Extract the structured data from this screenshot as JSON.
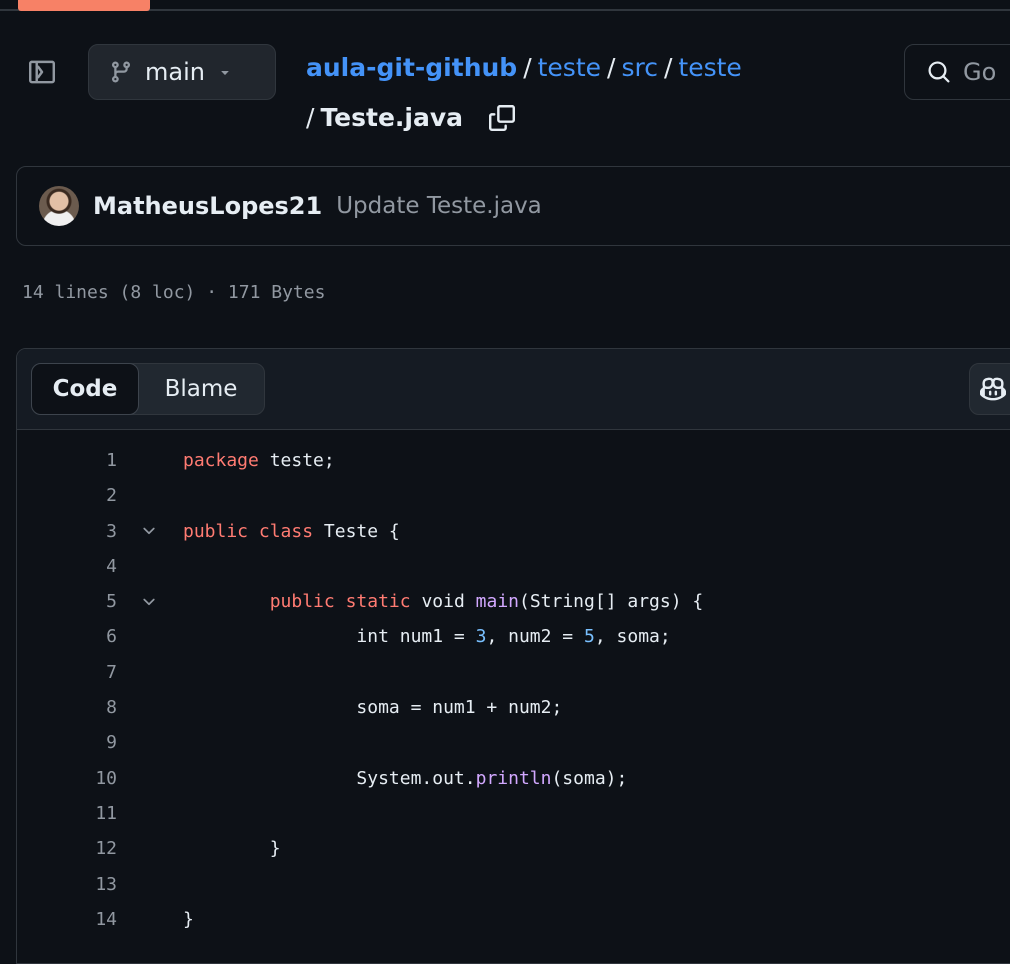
{
  "branch": {
    "name": "main"
  },
  "breadcrumb": {
    "repo": "aula-git-github",
    "parts": [
      "teste",
      "src",
      "teste"
    ],
    "separator": "/",
    "file": "Teste.java"
  },
  "search": {
    "placeholder": "Go to file",
    "visible_text": "Go"
  },
  "commit": {
    "author": "MatheusLopes21",
    "message": "Update Teste.java"
  },
  "file_meta": "14 lines (8 loc) · 171 Bytes",
  "view_tabs": {
    "code_label": "Code",
    "blame_label": "Blame"
  },
  "code": {
    "lines": [
      {
        "n": "1",
        "fold": false,
        "tokens": [
          [
            "kw",
            "package"
          ],
          [
            "t",
            " teste;"
          ]
        ]
      },
      {
        "n": "2",
        "fold": false,
        "tokens": []
      },
      {
        "n": "3",
        "fold": true,
        "tokens": [
          [
            "kw",
            "public"
          ],
          [
            "t",
            " "
          ],
          [
            "kw",
            "class"
          ],
          [
            "t",
            " Teste {"
          ]
        ]
      },
      {
        "n": "4",
        "fold": false,
        "tokens": []
      },
      {
        "n": "5",
        "fold": true,
        "tokens": [
          [
            "t",
            "\t"
          ],
          [
            "kw",
            "public"
          ],
          [
            "t",
            " "
          ],
          [
            "kw",
            "static"
          ],
          [
            "t",
            " void "
          ],
          [
            "fn",
            "main"
          ],
          [
            "t",
            "(String[] args) {"
          ]
        ]
      },
      {
        "n": "6",
        "fold": false,
        "tokens": [
          [
            "t",
            "\t\tint num1 = "
          ],
          [
            "num",
            "3"
          ],
          [
            "t",
            ", num2 = "
          ],
          [
            "num",
            "5"
          ],
          [
            "t",
            ", soma;"
          ]
        ]
      },
      {
        "n": "7",
        "fold": false,
        "tokens": []
      },
      {
        "n": "8",
        "fold": false,
        "tokens": [
          [
            "t",
            "\t\tsoma = num1 + num2;"
          ]
        ]
      },
      {
        "n": "9",
        "fold": false,
        "tokens": []
      },
      {
        "n": "10",
        "fold": false,
        "tokens": [
          [
            "t",
            "\t\tSystem.out."
          ],
          [
            "fn",
            "println"
          ],
          [
            "t",
            "(soma);"
          ]
        ]
      },
      {
        "n": "11",
        "fold": false,
        "tokens": []
      },
      {
        "n": "12",
        "fold": false,
        "tokens": [
          [
            "t",
            "\t}"
          ]
        ]
      },
      {
        "n": "13",
        "fold": false,
        "tokens": []
      },
      {
        "n": "14",
        "fold": false,
        "tokens": [
          [
            "t",
            "}"
          ]
        ]
      }
    ]
  },
  "colors": {
    "background": "#0d1117",
    "link": "#4493f8",
    "keyword": "#ff7b72",
    "function": "#d2a8ff",
    "number": "#79c0ff",
    "accent": "#f78166"
  }
}
